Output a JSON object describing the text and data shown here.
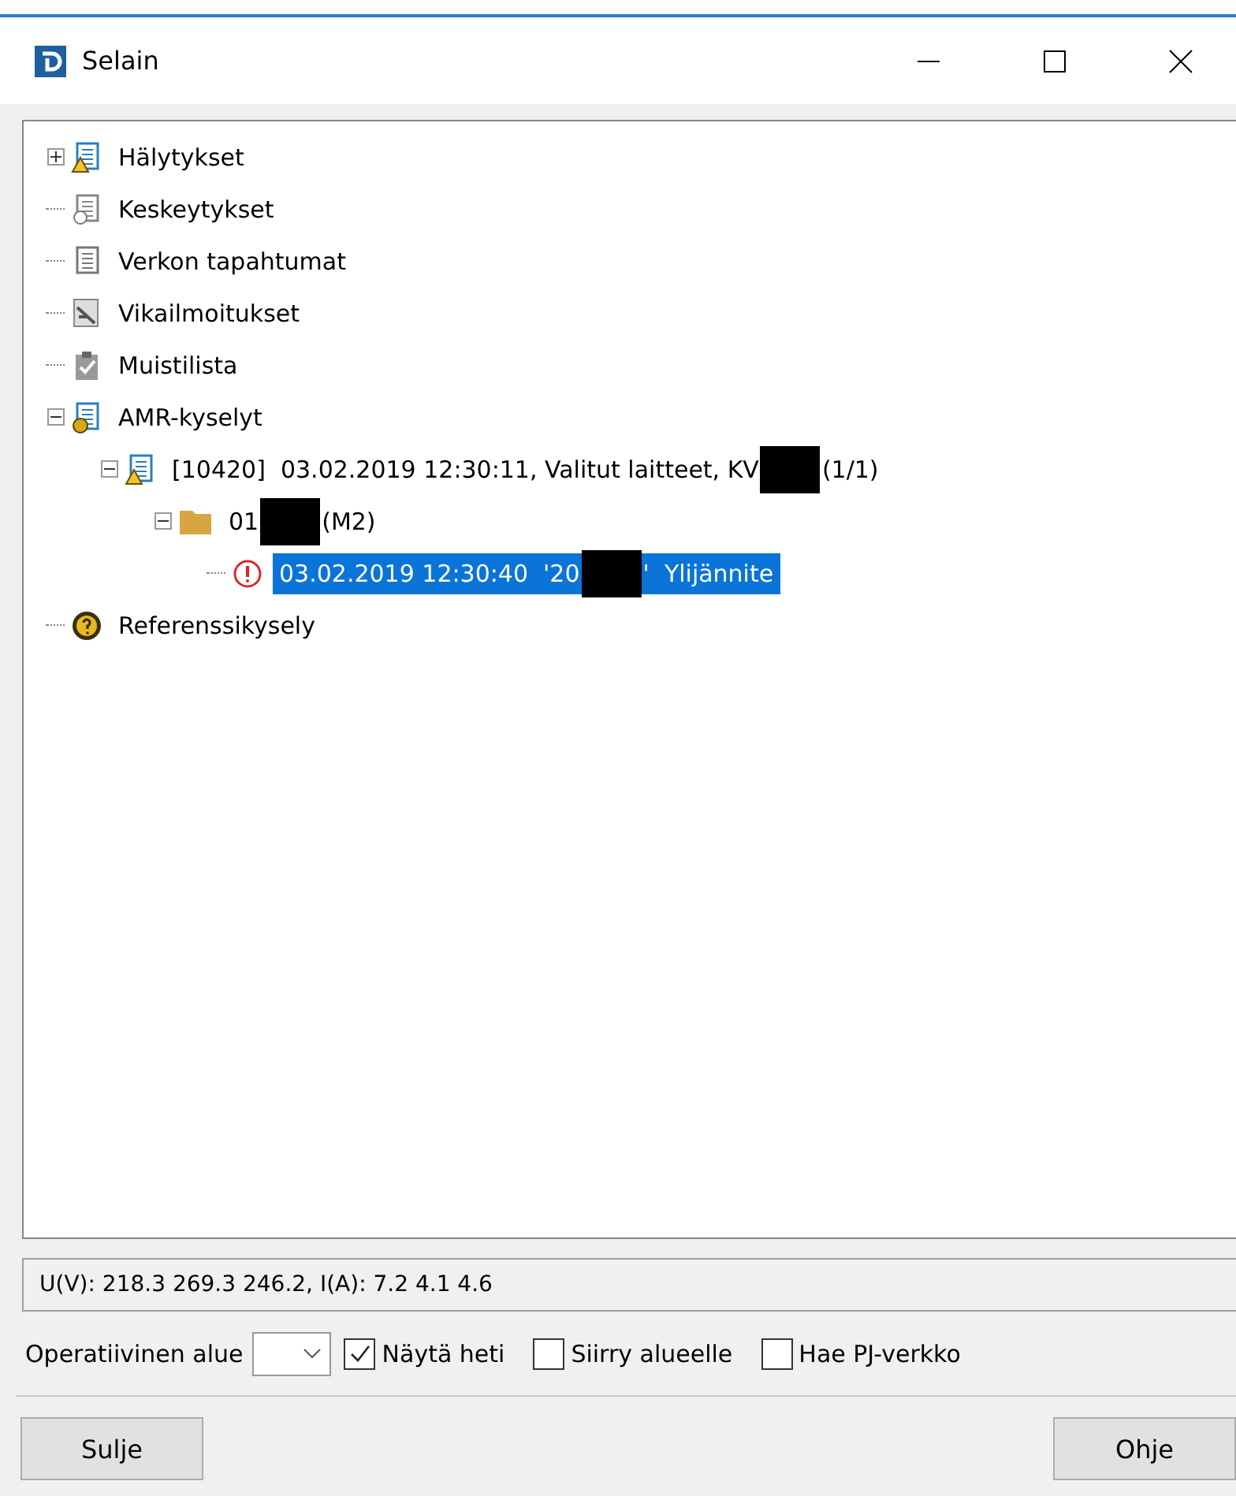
{
  "window": {
    "title": "Selain"
  },
  "tree": [
    {
      "kind": "warning-list",
      "parts": [
        "Hälytykset"
      ],
      "expanded": false,
      "selected": false
    },
    {
      "kind": "clock-list",
      "parts": [
        "Keskeytykset"
      ],
      "selected": false
    },
    {
      "kind": "plain-list",
      "parts": [
        "Verkon tapahtumat"
      ],
      "selected": false
    },
    {
      "kind": "fault",
      "parts": [
        "Vikailmoitukset"
      ],
      "selected": false
    },
    {
      "kind": "clipboard",
      "parts": [
        "Muistilista"
      ],
      "selected": false
    },
    {
      "kind": "query-list",
      "parts": [
        "AMR-kyselyt"
      ],
      "expanded": true,
      "selected": false,
      "children": [
        {
          "kind": "warning-list",
          "parts": [
            "[10420]  03.02.2019 12:30:11, Valitut laitteet, KV",
            "(1/1)"
          ],
          "expanded": true,
          "selected": false,
          "children": [
            {
              "kind": "folder",
              "parts": [
                "01",
                "(M2)"
              ],
              "expanded": true,
              "selected": false,
              "children": [
                {
                  "kind": "error",
                  "parts": [
                    "03.02.2019 12:30:40  '20",
                    "'  Ylijännite"
                  ],
                  "selected": true
                }
              ]
            }
          ]
        }
      ]
    },
    {
      "kind": "question",
      "parts": [
        "Referenssikysely"
      ],
      "selected": false
    }
  ],
  "status": "U(V): 218.3  269.3  246.2, I(A): 7.2  4.1  4.6",
  "options": {
    "label": "Operatiivinen alue",
    "checkboxes": [
      {
        "label": "Näytä heti",
        "checked": true
      },
      {
        "label": "Siirry alueelle",
        "checked": false
      },
      {
        "label": "Hae PJ-verkko",
        "checked": false
      }
    ]
  },
  "buttons": [
    "Sulje",
    "Ohje"
  ]
}
